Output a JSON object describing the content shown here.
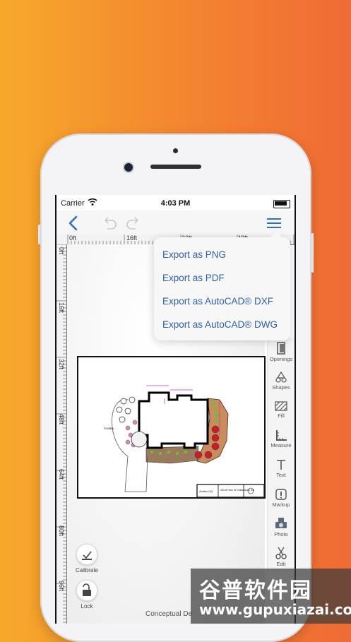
{
  "status_bar": {
    "carrier": "Carrier",
    "time": "4:03 PM"
  },
  "navigation": {
    "back_icon": "chevron-left-icon",
    "undo_icon": "undo-icon",
    "redo_icon": "redo-icon",
    "menu_icon": "hamburger-menu-icon"
  },
  "ruler": {
    "top_labels": [
      "0ft",
      "16ft",
      "32ft",
      "48ft"
    ],
    "left_labels": [
      "0ft",
      "16ft",
      "32ft",
      "48ft",
      "64ft",
      "80ft",
      "96ft"
    ]
  },
  "export_menu": {
    "items": [
      "Export as PNG",
      "Export as PDF",
      "Export as AutoCAD® DXF",
      "Export as AutoCAD® DWG"
    ]
  },
  "tools": [
    {
      "label": "Openings",
      "icon": "door-icon"
    },
    {
      "label": "Shapes",
      "icon": "shapes-icon"
    },
    {
      "label": "Fill",
      "icon": "hatch-fill-icon"
    },
    {
      "label": "Measure",
      "icon": "ruler-icon"
    },
    {
      "label": "Text",
      "icon": "text-icon"
    },
    {
      "label": "Markup",
      "icon": "markup-icon"
    },
    {
      "label": "Photo",
      "icon": "camera-icon"
    },
    {
      "label": "Edit",
      "icon": "scissors-icon"
    }
  ],
  "left_buttons": {
    "calibrate": "Calibrate",
    "lock": "Lock"
  },
  "footer_title": "Conceptual De",
  "drawing": {
    "label_plant": "Azalea",
    "label_title_block_left": "Arcitex HQ",
    "label_title_block_addr": "434 W Vine St. Kalamazoo, MI"
  },
  "watermark": {
    "text_cn": "谷普软件园",
    "url": "www.gupuxiazai.com"
  },
  "colors": {
    "accent": "#2f6fbf",
    "background_start": "#f6a92b",
    "background_end": "#f06a35"
  }
}
